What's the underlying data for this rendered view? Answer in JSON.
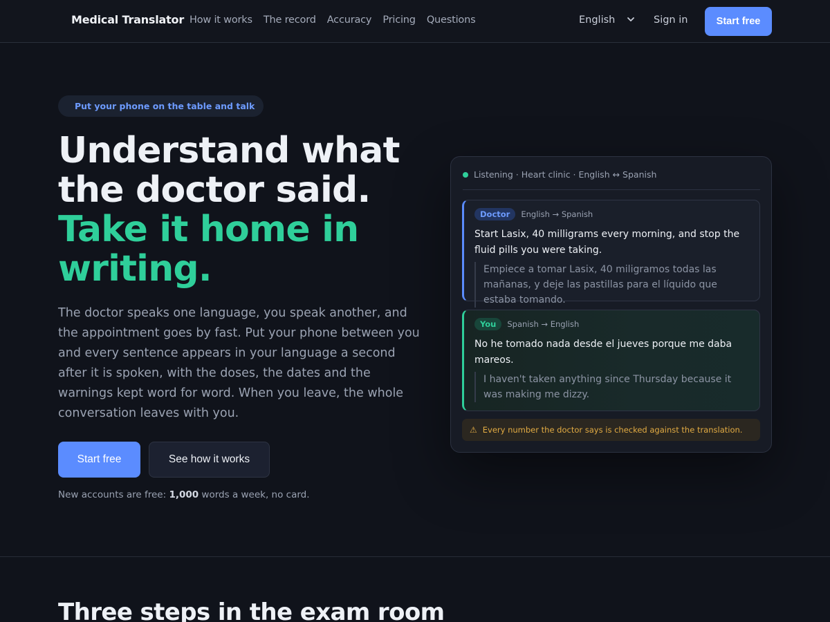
{
  "nav": {
    "brand": "Medical Translator",
    "links": [
      "How it works",
      "The record",
      "Accuracy",
      "Pricing",
      "Questions"
    ],
    "language": "English",
    "sign_in": "Sign in",
    "cta": "Start free"
  },
  "hero": {
    "pill": "Put your phone on the table and talk",
    "title_line1": "Understand what",
    "title_line2": "the doctor said.",
    "title_line3": "Take it home in writing.",
    "lede": "The doctor speaks one language, you speak another, and the appointment goes by fast. Put your phone between you and every sentence appears in your language a second after it is spoken, with the doses, the dates and the warnings kept word for word. When you leave, the whole conversation leaves with you.",
    "primary_button": "Start free",
    "secondary_button": "See how it works",
    "fine_pre": "New accounts are free: ",
    "fine_bold": "1,000",
    "fine_post": " words a week, no card."
  },
  "card": {
    "status": "Listening · Heart clinic · English ↔ Spanish",
    "messages": [
      {
        "speaker": "Doctor",
        "direction": "English → Spanish",
        "original": "Start Lasix, 40 milligrams every morning, and stop the fluid pills you were taking.",
        "translation": "Empiece a tomar Lasix, 40 miligramos todas las mañanas, y deje las pastillas para el líquido que estaba tomando."
      },
      {
        "speaker": "You",
        "direction": "Spanish → English",
        "original": "No he tomado nada desde el jueves porque me daba mareos.",
        "translation": "I haven't taken anything since Thursday because it was making me dizzy."
      }
    ],
    "warning": "Every number the doctor says is checked against the translation."
  },
  "section2": {
    "heading": "Three steps in the exam room"
  },
  "colors": {
    "background": "#10131b",
    "accent_blue": "#5b8cff",
    "accent_green": "#2fcf9a",
    "warning_amber": "#e2ab43"
  }
}
